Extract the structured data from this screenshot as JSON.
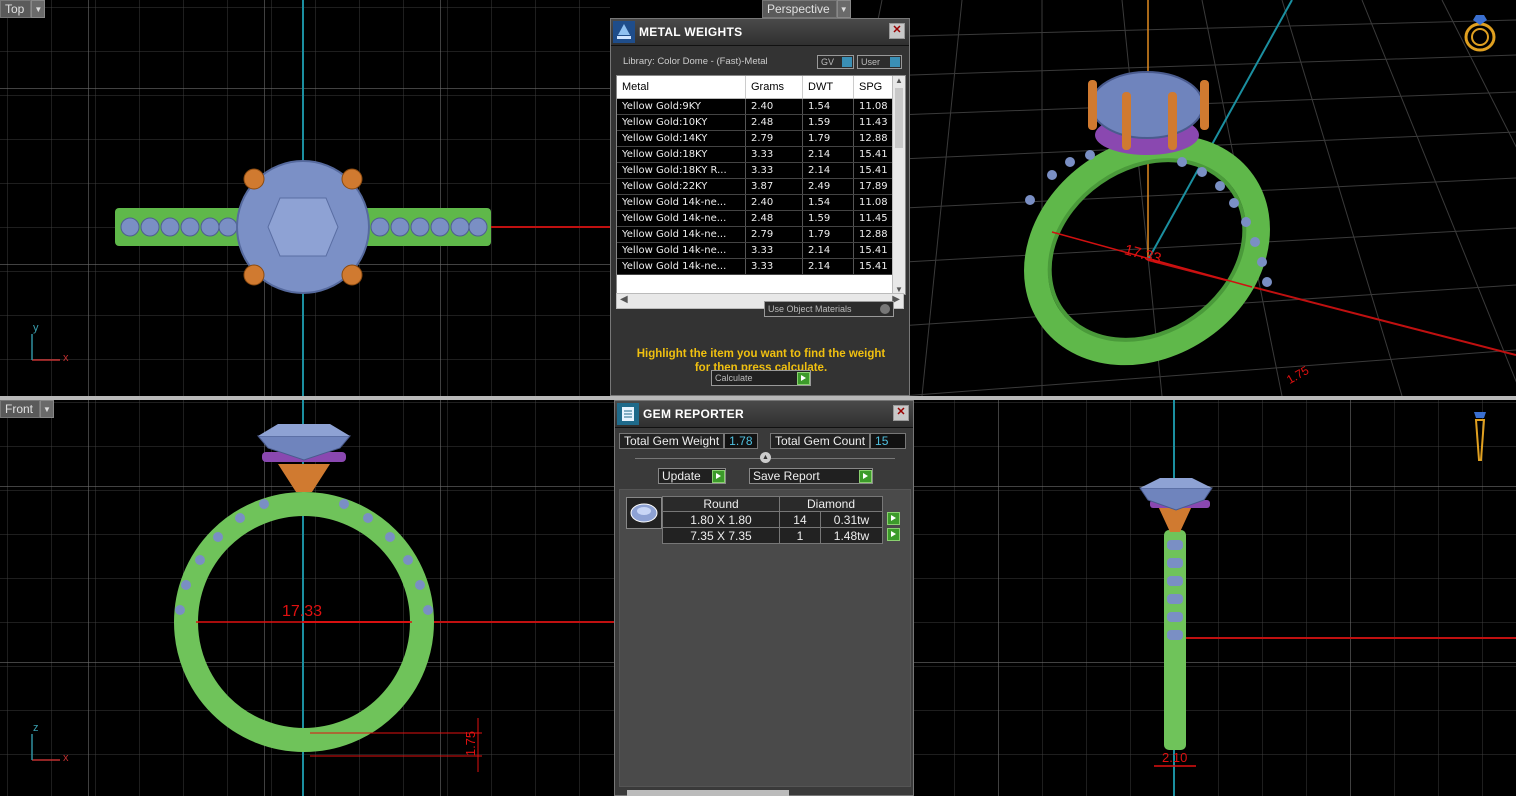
{
  "viewports": {
    "top": {
      "label": "Top",
      "axis_a": "y",
      "axis_b": "x"
    },
    "perspective": {
      "label": "Perspective",
      "dim_size": "17.33",
      "dim_small": "1.75"
    },
    "front": {
      "label": "Front",
      "axis_a": "z",
      "axis_b": "x",
      "dim_size": "17.33",
      "dim_small": "1.75"
    },
    "side": {
      "dim_width": "2.10"
    }
  },
  "metal_weights": {
    "title": "METAL WEIGHTS",
    "library": "Library: Color Dome - (Fast)-Metal",
    "gv_label": "GV",
    "user_label": "User",
    "columns": [
      "Metal",
      "Grams",
      "DWT",
      "SPG"
    ],
    "rows": [
      [
        "Yellow Gold:9KY",
        "2.40",
        "1.54",
        "11.08"
      ],
      [
        "Yellow Gold:10KY",
        "2.48",
        "1.59",
        "11.43"
      ],
      [
        "Yellow Gold:14KY",
        "2.79",
        "1.79",
        "12.88"
      ],
      [
        "Yellow Gold:18KY",
        "3.33",
        "2.14",
        "15.41"
      ],
      [
        "Yellow Gold:18KY R...",
        "3.33",
        "2.14",
        "15.41"
      ],
      [
        "Yellow Gold:22KY",
        "3.87",
        "2.49",
        "17.89"
      ],
      [
        "Yellow Gold 14k-ne...",
        "2.40",
        "1.54",
        "11.08"
      ],
      [
        "Yellow Gold 14k-ne...",
        "2.48",
        "1.59",
        "11.45"
      ],
      [
        "Yellow Gold 14k-ne...",
        "2.79",
        "1.79",
        "12.88"
      ],
      [
        "Yellow Gold 14k-ne...",
        "3.33",
        "2.14",
        "15.41"
      ],
      [
        "Yellow Gold 14k-ne...",
        "3.33",
        "2.14",
        "15.41"
      ]
    ],
    "use_object_materials": "Use Object Materials",
    "instruction_line1": "Highlight the item you want to find the weight",
    "instruction_line2": "for then press calculate.",
    "calculate_label": "Calculate"
  },
  "gem_reporter": {
    "title": "GEM REPORTER",
    "total_weight_label": "Total Gem Weight",
    "total_weight_value": "1.78",
    "total_count_label": "Total Gem Count",
    "total_count_value": "15",
    "update_label": "Update",
    "save_report_label": "Save Report",
    "shape": "Round",
    "gem_type": "Diamond",
    "rows": [
      {
        "size": "1.80 X 1.80",
        "count": "14",
        "weight": "0.31tw"
      },
      {
        "size": "7.35 X 7.35",
        "count": "1",
        "weight": "1.48tw"
      }
    ]
  },
  "colors": {
    "band": "#6fc35a",
    "gem": "#7a8fc4",
    "prong": "#d07a30",
    "gallery": "#8a48b0",
    "dimension": "#e01010",
    "axis_cyan": "#1b8fa0",
    "text_yellow": "#f0c010"
  }
}
